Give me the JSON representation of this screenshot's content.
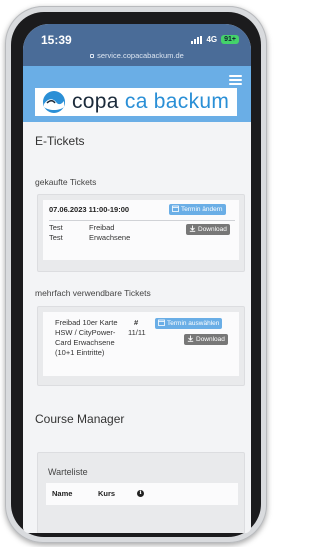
{
  "status_bar": {
    "time": "15:39",
    "network": "4G",
    "battery": "91+",
    "url": "service.copacabackum.de"
  },
  "header": {
    "logo_part1": "copa",
    "logo_part2": "ca backum",
    "menu_icon": "hamburger-icon"
  },
  "page": {
    "title": "E-Tickets"
  },
  "bought_tickets": {
    "heading": "gekaufte Tickets",
    "ticket": {
      "date_time": "07.06.2023 11:00-19:00",
      "reschedule_label": "Termin ändern",
      "rows": [
        {
          "name": "Test",
          "type": "Freibad"
        },
        {
          "name": "Test",
          "type": "Erwachsene"
        }
      ],
      "download_label": "Download"
    }
  },
  "multi_tickets": {
    "heading": "mehrfach verwendbare Tickets",
    "ticket": {
      "description_lines": [
        "Freibad 10er Karte",
        "HSW / CityPower-",
        "Card Erwachsene",
        "(10+1 Eintritte)"
      ],
      "count_header": "#",
      "count_value": "11/11",
      "select_date_label": "Termin auswählen",
      "download_label": "Download"
    }
  },
  "course_manager": {
    "title": "Course Manager",
    "waitlist": {
      "heading": "Warteliste",
      "columns": [
        "Name",
        "Kurs"
      ],
      "info_icon": "info-circle-icon"
    }
  },
  "colors": {
    "accent": "#6aaee6",
    "status_bar": "#4a6c98",
    "download_button": "#777777"
  }
}
